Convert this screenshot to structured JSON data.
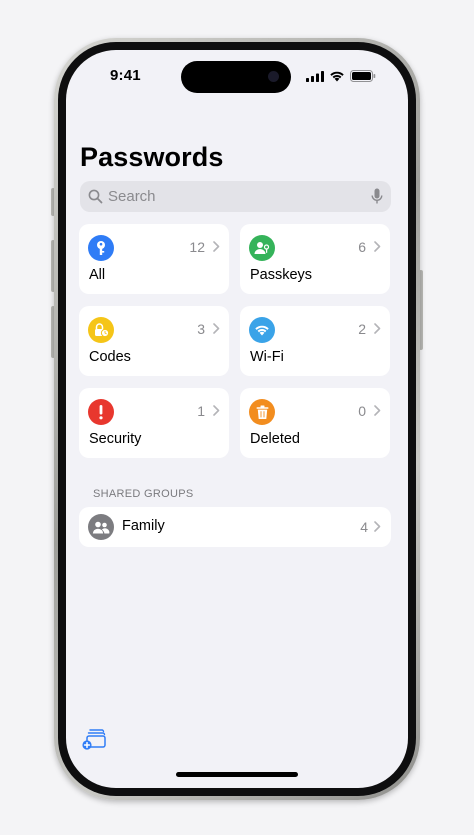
{
  "status_bar": {
    "time": "9:41"
  },
  "app": {
    "title": "Passwords"
  },
  "search": {
    "placeholder": "Search"
  },
  "categories": [
    {
      "label": "All",
      "count": "12",
      "icon": "key-icon",
      "color": "#2f7cf6"
    },
    {
      "label": "Passkeys",
      "count": "6",
      "icon": "person-key-icon",
      "color": "#35b35a"
    },
    {
      "label": "Codes",
      "count": "3",
      "icon": "lock-clock-icon",
      "color": "#f5c518"
    },
    {
      "label": "Wi-Fi",
      "count": "2",
      "icon": "wifi-icon",
      "color": "#3aa3e8"
    },
    {
      "label": "Security",
      "count": "1",
      "icon": "exclamation-icon",
      "color": "#e8372e"
    },
    {
      "label": "Deleted",
      "count": "0",
      "icon": "trash-icon",
      "color": "#f28d1f"
    }
  ],
  "shared_groups": {
    "header": "SHARED GROUPS",
    "items": [
      {
        "label": "Family",
        "count": "4",
        "icon": "people-icon",
        "color": "#7c7c80"
      }
    ]
  },
  "toolbar": {
    "new_group_icon": "new-shared-group-icon",
    "accent": "#2f7cf6"
  }
}
